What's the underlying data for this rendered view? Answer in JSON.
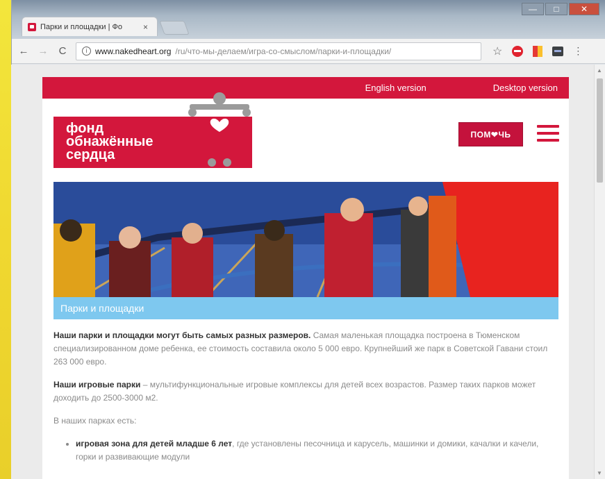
{
  "browser": {
    "tab_title": "Парки и площадки | Фо",
    "tab_close": "×",
    "url_host": "www.nakedheart.org",
    "url_path": "/ru/что-мы-делаем/игра-со-смыслом/парки-и-площадки/",
    "back": "←",
    "forward": "→",
    "reload": "C",
    "info": "i",
    "star": "☆",
    "menu": "⋮",
    "win_min": "—",
    "win_max": "□",
    "win_close": "✕"
  },
  "site": {
    "topbar": {
      "english": "English version",
      "desktop": "Desktop version"
    },
    "logo": {
      "line1": "фонд",
      "line2": "обнажённые",
      "line3": "сердца"
    },
    "help_button": "ПОМ❤ЧЬ",
    "hero_caption": "Парки и площадки"
  },
  "content": {
    "p1_bold": "Наши парки и площадки могут быть самых разных размеров.",
    "p1_text": " Самая маленькая площадка построена в Тюменском специализированном доме ребенка, ее стоимость составила около 5 000 евро. Крупнейший же парк в Советской Гавани стоил 263 000 евро.",
    "p2_bold": "Наши игровые парки",
    "p2_text": " – мультифункциональные игровые комплексы для детей всех возрастов. Размер таких парков может доходить до 2500-3000 м2.",
    "p3": "В наших парках есть:",
    "li1_bold": "игровая зона для детей младше 6 лет",
    "li1_text": ", где установлены песочница и карусель, машинки и домики, качалки и качели, горки и развивающие модули"
  },
  "colors": {
    "brand": "#d3173c",
    "caption": "#7ec8ef"
  }
}
